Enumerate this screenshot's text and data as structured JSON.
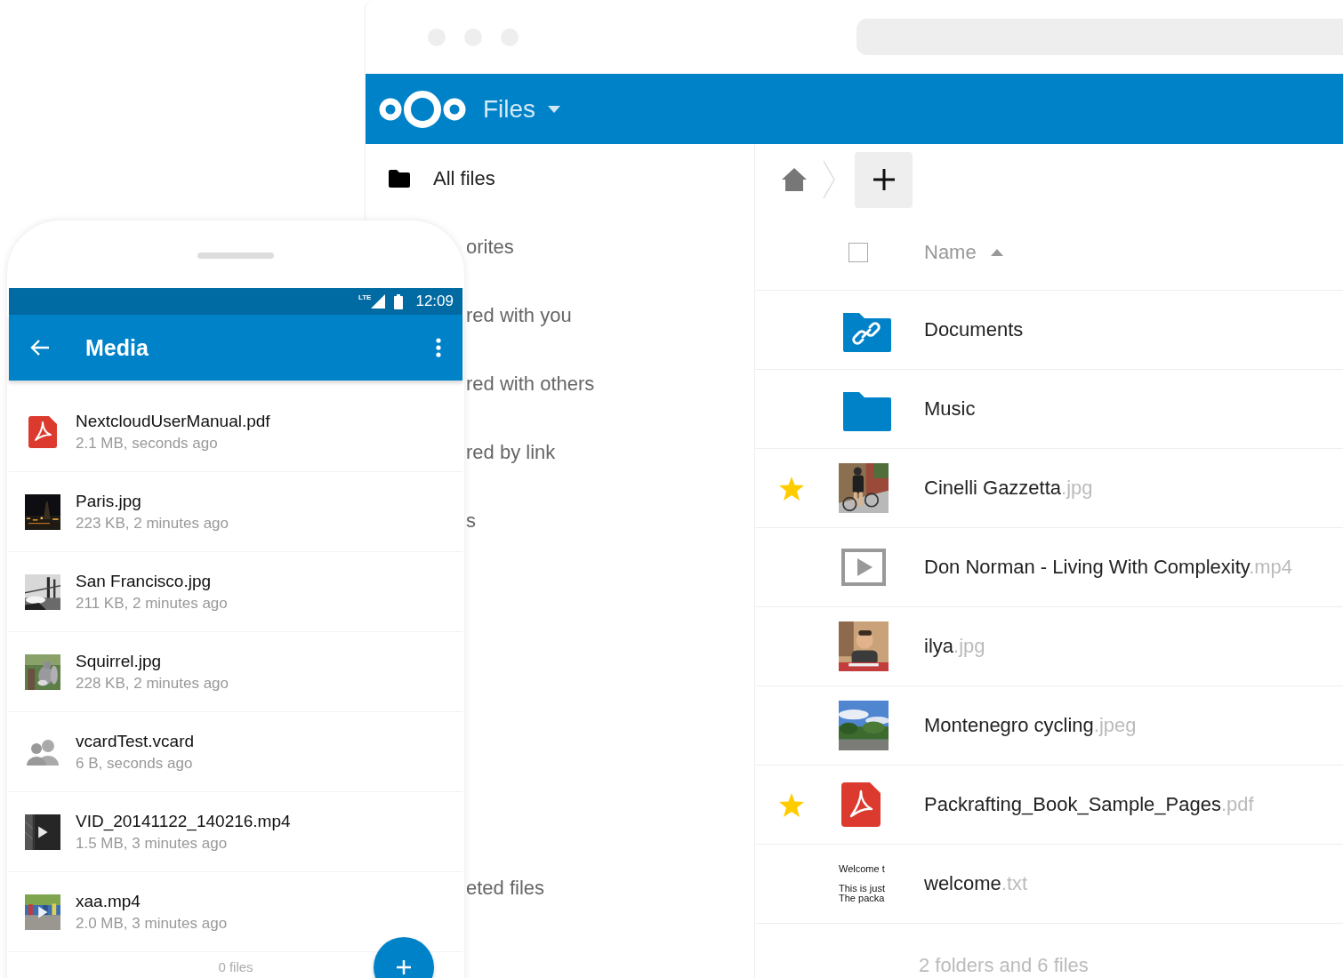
{
  "desktop": {
    "app": {
      "title": "Files"
    },
    "sidebar": {
      "items": [
        {
          "label": "All files",
          "kind": "folder"
        },
        {
          "label": "orites",
          "kind": "covered"
        },
        {
          "label": "red with you",
          "kind": "covered"
        },
        {
          "label": "red with others",
          "kind": "covered"
        },
        {
          "label": "red by link",
          "kind": "covered"
        },
        {
          "label": "s",
          "kind": "covered"
        }
      ],
      "bottom_items": [
        {
          "label": "eted files",
          "kind": "covered"
        }
      ]
    },
    "table": {
      "select_all_checked": false,
      "columns": [
        {
          "label": "Name",
          "sort_ascending": true
        }
      ],
      "rows": [
        {
          "name": "Documents",
          "kind": "shared-folder",
          "favorite": false
        },
        {
          "name": "Music",
          "kind": "folder",
          "favorite": false
        },
        {
          "name": "Cinelli Gazzetta.jpg",
          "kind": "picture",
          "favorite": true
        },
        {
          "name": "Don Norman - Living With Complexity.mp4",
          "kind": "video",
          "favorite": false
        },
        {
          "name": "ilya.jpg",
          "kind": "picture",
          "favorite": false
        },
        {
          "name": "Montenegro cycling.jpeg",
          "kind": "picture",
          "favorite": false
        },
        {
          "name": "Packrafting_Book_Sample_Pages.pdf",
          "kind": "pdf",
          "favorite": true
        },
        {
          "name": "welcome.txt",
          "kind": "text",
          "preview": [
            "Welcome t",
            "This is just",
            "The packa"
          ],
          "favorite": false
        }
      ],
      "summary": "2 folders and 6 files"
    }
  },
  "phone": {
    "status_bar": {
      "network": "LTE",
      "time": "12:09"
    },
    "toolbar": {
      "title": "Media"
    },
    "items": [
      {
        "name": "NextcloudUserManual.pdf",
        "meta": "2.1 MB, seconds ago",
        "kind": "pdf"
      },
      {
        "name": "Paris.jpg",
        "meta": "223 KB, 2 minutes ago",
        "kind": "picture"
      },
      {
        "name": "San Francisco.jpg",
        "meta": "211 KB, 2 minutes ago",
        "kind": "picture"
      },
      {
        "name": "Squirrel.jpg",
        "meta": "228 KB, 2 minutes ago",
        "kind": "picture"
      },
      {
        "name": "vcardTest.vcard",
        "meta": "6 B, seconds ago",
        "kind": "contact"
      },
      {
        "name": "VID_20141122_140216.mp4",
        "meta": "1.5 MB, 3 minutes ago",
        "kind": "video"
      },
      {
        "name": "xaa.mp4",
        "meta": "2.0 MB, 3 minutes ago",
        "kind": "video"
      }
    ],
    "footer": "0 files"
  }
}
